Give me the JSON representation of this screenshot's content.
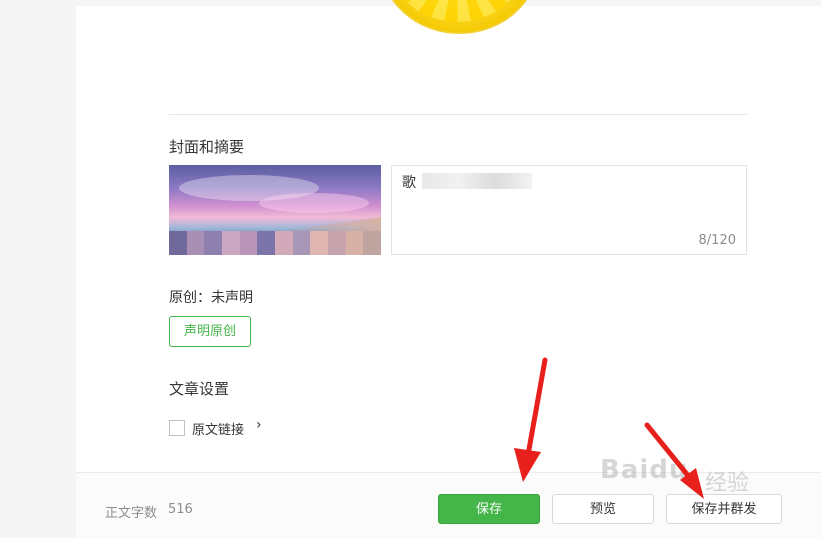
{
  "cover_section": {
    "title": "封面和摘要",
    "summary_text": "歌",
    "summary_count": "8/120"
  },
  "original_section": {
    "label": "原创：未声明",
    "declare_button": "声明原创"
  },
  "article_settings": {
    "title": "文章设置",
    "original_link_label": "原文链接",
    "original_link_checked": false,
    "chevron": "›"
  },
  "bottom_bar": {
    "word_count_label": "正文字数",
    "word_count_value": "516",
    "save_label": "保存",
    "preview_label": "预览",
    "save_send_label": "保存并群发"
  },
  "watermark": {
    "brand": "Baidu",
    "sub": "经验"
  },
  "colors": {
    "accent_green": "#44b549",
    "arrow_red": "#e8201b"
  }
}
